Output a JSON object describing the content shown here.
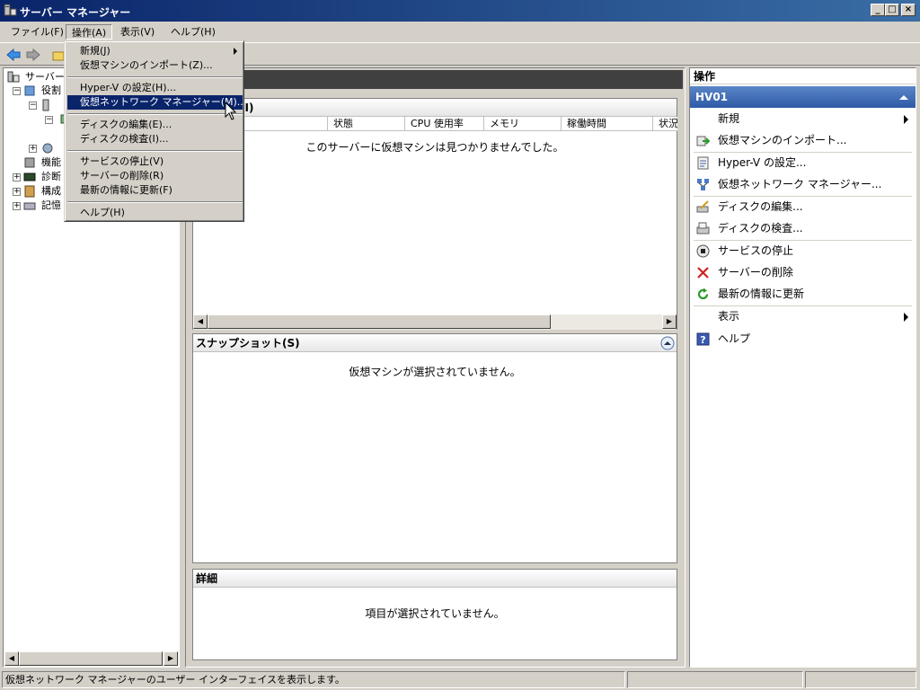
{
  "window": {
    "title": "サーバー マネージャー"
  },
  "menubar": [
    {
      "label": "ファイル(F)"
    },
    {
      "label": "操作(A)"
    },
    {
      "label": "表示(V)"
    },
    {
      "label": "ヘルプ(H)"
    }
  ],
  "tree": {
    "items": [
      {
        "label": "サーバー"
      },
      {
        "label": "役割"
      },
      {
        "label": ""
      },
      {
        "label": ""
      },
      {
        "label": ""
      },
      {
        "label": "機能"
      },
      {
        "label": "診断"
      },
      {
        "label": "構成"
      },
      {
        "label": "記憶"
      }
    ]
  },
  "center": {
    "vm_panel": {
      "title_fragment": "(I)",
      "columns": [
        "状態",
        "CPU 使用率",
        "メモリ",
        "稼働時間",
        "状況"
      ],
      "empty_message": "このサーバーに仮想マシンは見つかりませんでした。"
    },
    "snapshot_panel": {
      "title": "スナップショット(S)",
      "empty_message": "仮想マシンが選択されていません。"
    },
    "details_panel": {
      "title": "詳細",
      "empty_message": "項目が選択されていません。"
    }
  },
  "actions": {
    "header": "操作",
    "server": "HV01",
    "items": [
      {
        "label": "新規"
      },
      {
        "label": "仮想マシンのインポート..."
      },
      {
        "label": "Hyper-V の設定..."
      },
      {
        "label": "仮想ネットワーク マネージャー..."
      },
      {
        "label": "ディスクの編集..."
      },
      {
        "label": "ディスクの検査..."
      },
      {
        "label": "サービスの停止"
      },
      {
        "label": "サーバーの削除"
      },
      {
        "label": "最新の情報に更新"
      },
      {
        "label": "表示"
      },
      {
        "label": "ヘルプ"
      }
    ]
  },
  "dropdown": {
    "items": [
      {
        "label": "新規(J)"
      },
      {
        "label": "仮想マシンのインポート(Z)..."
      },
      {
        "label": "Hyper-V の設定(H)..."
      },
      {
        "label": "仮想ネットワーク マネージャー(M)..."
      },
      {
        "label": "ディスクの編集(E)..."
      },
      {
        "label": "ディスクの検査(I)..."
      },
      {
        "label": "サービスの停止(V)"
      },
      {
        "label": "サーバーの削除(R)"
      },
      {
        "label": "最新の情報に更新(F)"
      },
      {
        "label": "ヘルプ(H)"
      }
    ]
  },
  "statusbar": {
    "text": "仮想ネットワーク マネージャーのユーザー インターフェイスを表示します。"
  },
  "colors": {
    "titlebar": "#0a246a",
    "highlight": "#0a246a",
    "actions_bar": "#2f5aa6",
    "face": "#d4d0c8"
  }
}
